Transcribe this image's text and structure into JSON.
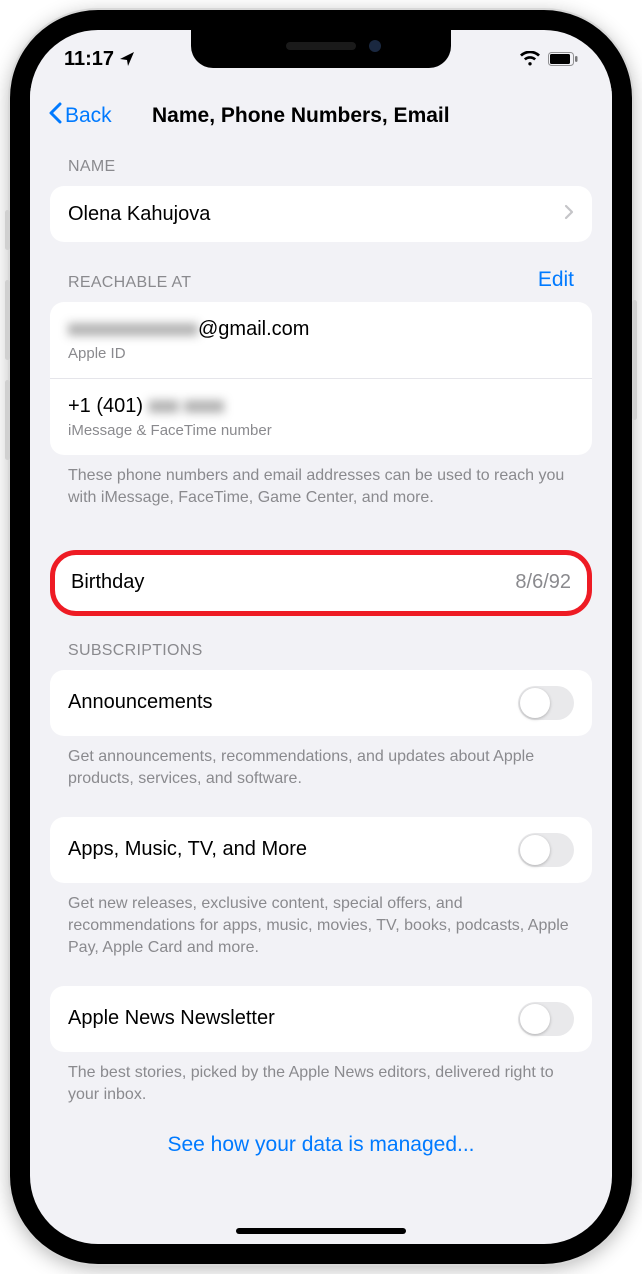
{
  "status": {
    "time": "11:17"
  },
  "nav": {
    "back_label": "Back",
    "title": "Name, Phone Numbers, Email"
  },
  "sections": {
    "name": {
      "header": "NAME",
      "value": "Olena Kahujova"
    },
    "reachable": {
      "header": "REACHABLE AT",
      "edit_label": "Edit",
      "email_redacted": "xxxxxxxxxxxxx",
      "email_suffix": "@gmail.com",
      "email_sub": "Apple ID",
      "phone_prefix": "+1 (401) ",
      "phone_redacted": "xxx xxxx",
      "phone_sub": "iMessage & FaceTime number",
      "footer": "These phone numbers and email addresses can be used to reach you with iMessage, FaceTime, Game Center, and more."
    },
    "birthday": {
      "label": "Birthday",
      "value": "8/6/92"
    },
    "subs": {
      "header": "SUBSCRIPTIONS",
      "announcements": {
        "label": "Announcements",
        "footer": "Get announcements, recommendations, and updates about Apple products, services, and software."
      },
      "apps": {
        "label": "Apps, Music, TV, and More",
        "footer": "Get new releases, exclusive content, special offers, and recommendations for apps, music, movies, TV, books, podcasts, Apple Pay, Apple Card and more."
      },
      "news": {
        "label": "Apple News Newsletter",
        "footer": "The best stories, picked by the Apple News editors, delivered right to your inbox."
      }
    },
    "data_link": "See how your data is managed..."
  }
}
